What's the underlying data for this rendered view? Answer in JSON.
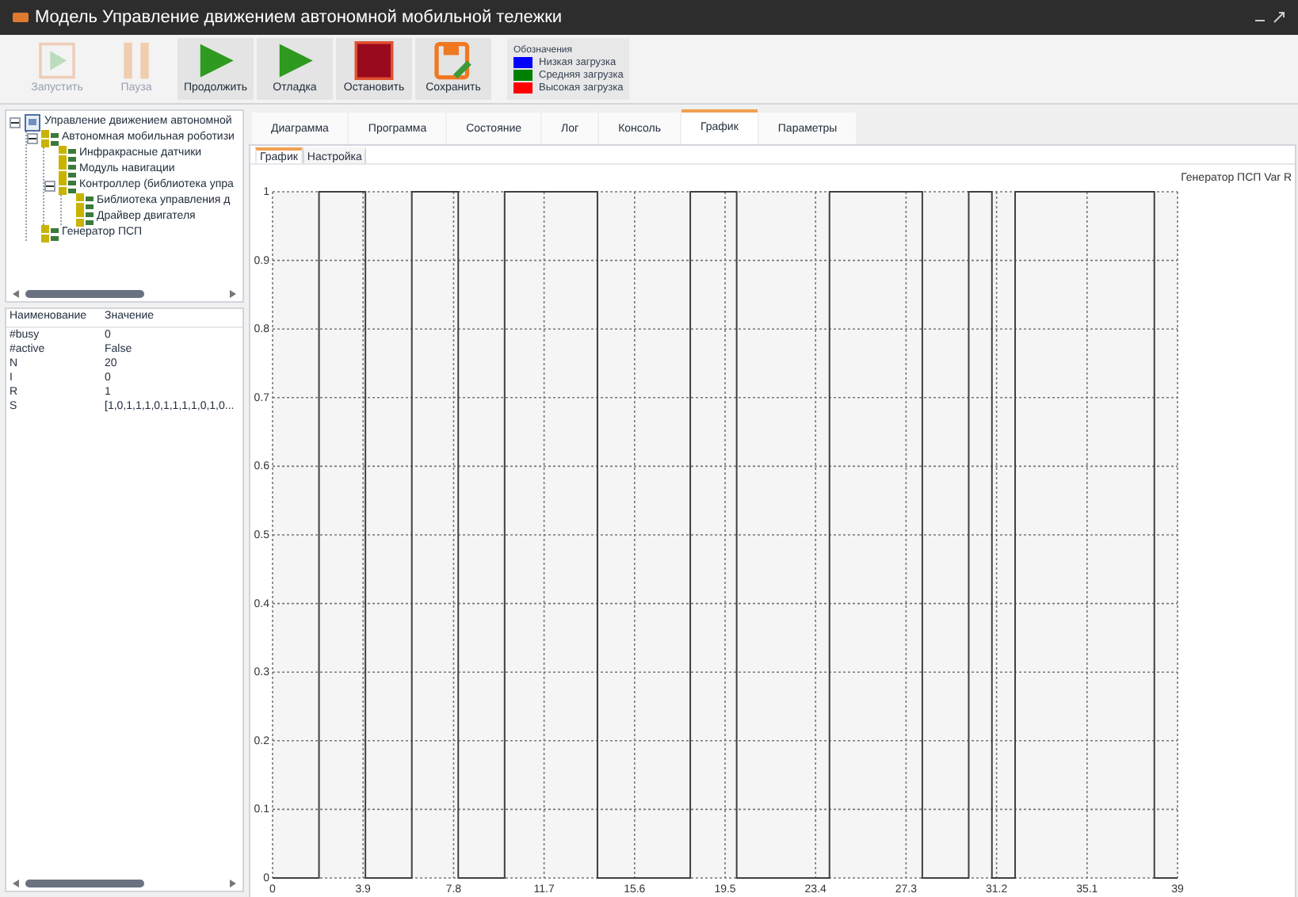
{
  "window": {
    "title": "Модель Управление движением автономной мобильной тележки"
  },
  "toolbar": [
    {
      "label": "Запустить",
      "kind": "play",
      "disabled": true
    },
    {
      "label": "Пауза",
      "kind": "pause",
      "disabled": true
    },
    {
      "label": "Продолжить",
      "kind": "play",
      "disabled": false
    },
    {
      "label": "Отладка",
      "kind": "play",
      "disabled": false
    },
    {
      "label": "Остановить",
      "kind": "stop",
      "disabled": false
    },
    {
      "label": "Сохранить",
      "kind": "save",
      "disabled": false
    }
  ],
  "legend": {
    "title": "Обозначения",
    "items": [
      {
        "label": "Низкая загрузка",
        "color": "#0000ff"
      },
      {
        "label": "Средняя загрузка",
        "color": "#008000"
      },
      {
        "label": "Высокая загрузка",
        "color": "#ff0000"
      }
    ]
  },
  "tree": [
    {
      "label": "Управление движением автономной",
      "kind": "model",
      "expanded": true,
      "children": [
        {
          "label": "Автономная мобильная роботизи",
          "kind": "block",
          "expanded": true,
          "children": [
            {
              "label": "Инфракрасные датчики",
              "kind": "block"
            },
            {
              "label": "Модуль навигации",
              "kind": "block"
            },
            {
              "label": "Контроллер (библиотека упра",
              "kind": "block",
              "expanded": true,
              "children": [
                {
                  "label": "Библиотека управления д",
                  "kind": "block"
                },
                {
                  "label": "Драйвер двигателя",
                  "kind": "block"
                }
              ]
            }
          ]
        },
        {
          "label": "Генератор ПСП",
          "kind": "block"
        }
      ]
    }
  ],
  "properties": {
    "columns": [
      "Наименование",
      "Значение"
    ],
    "rows": [
      [
        "#busy",
        "0"
      ],
      [
        "#active",
        "False"
      ],
      [
        "N",
        "20"
      ],
      [
        "I",
        "0"
      ],
      [
        "R",
        "1"
      ],
      [
        "S",
        "[1,0,1,1,1,0,1,1,1,1,0,1,0..."
      ]
    ]
  },
  "tabs": [
    {
      "label": "Диаграмма",
      "selected": false
    },
    {
      "label": "Программа",
      "selected": false
    },
    {
      "label": "Состояние",
      "selected": false
    },
    {
      "label": "Лог",
      "selected": false
    },
    {
      "label": "Консоль",
      "selected": false
    },
    {
      "label": "График",
      "selected": true
    },
    {
      "label": "Параметры",
      "selected": false
    }
  ],
  "subtabs": [
    {
      "label": "График",
      "selected": true
    },
    {
      "label": "Настройка",
      "selected": false
    }
  ],
  "chart": {
    "chart_data": {
      "type": "line",
      "x": [
        0,
        2,
        2,
        4,
        4,
        6,
        6,
        8,
        8,
        10,
        10,
        14,
        14,
        18,
        18,
        20,
        20,
        24,
        24,
        28,
        28,
        30,
        30,
        31,
        31,
        32,
        32,
        38,
        38,
        39
      ],
      "series": [
        {
          "name": "Генератор ПСП Var R",
          "color": "#404040",
          "values": [
            0,
            0,
            1,
            1,
            0,
            0,
            1,
            1,
            0,
            0,
            1,
            1,
            0,
            0,
            1,
            1,
            0,
            0,
            1,
            1,
            0,
            0,
            1,
            1,
            0,
            0,
            1,
            1,
            0,
            0
          ]
        }
      ],
      "xlim": [
        0,
        39
      ],
      "ylim": [
        0,
        1
      ],
      "grid": true,
      "xticks": [
        {
          "value": 0,
          "label": "0"
        },
        {
          "value": 3.9,
          "label": "3.9"
        },
        {
          "value": 7.8,
          "label": "7.8"
        },
        {
          "value": 11.7,
          "label": "11.7"
        },
        {
          "value": 15.6,
          "label": "15.6"
        },
        {
          "value": 19.5,
          "label": "19.5"
        },
        {
          "value": 23.4,
          "label": "23.4"
        },
        {
          "value": 27.3,
          "label": "27.3"
        },
        {
          "value": 31.2,
          "label": "31.2"
        },
        {
          "value": 35.1,
          "label": "35.1"
        },
        {
          "value": 39,
          "label": "39"
        }
      ],
      "yticks": [
        {
          "value": 0,
          "label": "0"
        },
        {
          "value": 0.1,
          "label": "0.1"
        },
        {
          "value": 0.2,
          "label": "0.2"
        },
        {
          "value": 0.3,
          "label": "0.3"
        },
        {
          "value": 0.4,
          "label": "0.4"
        },
        {
          "value": 0.5,
          "label": "0.5"
        },
        {
          "value": 0.6,
          "label": "0.6"
        },
        {
          "value": 0.7,
          "label": "0.7"
        },
        {
          "value": 0.8,
          "label": "0.8"
        },
        {
          "value": 0.9,
          "label": "0.9"
        },
        {
          "value": 1,
          "label": "1"
        }
      ]
    }
  }
}
